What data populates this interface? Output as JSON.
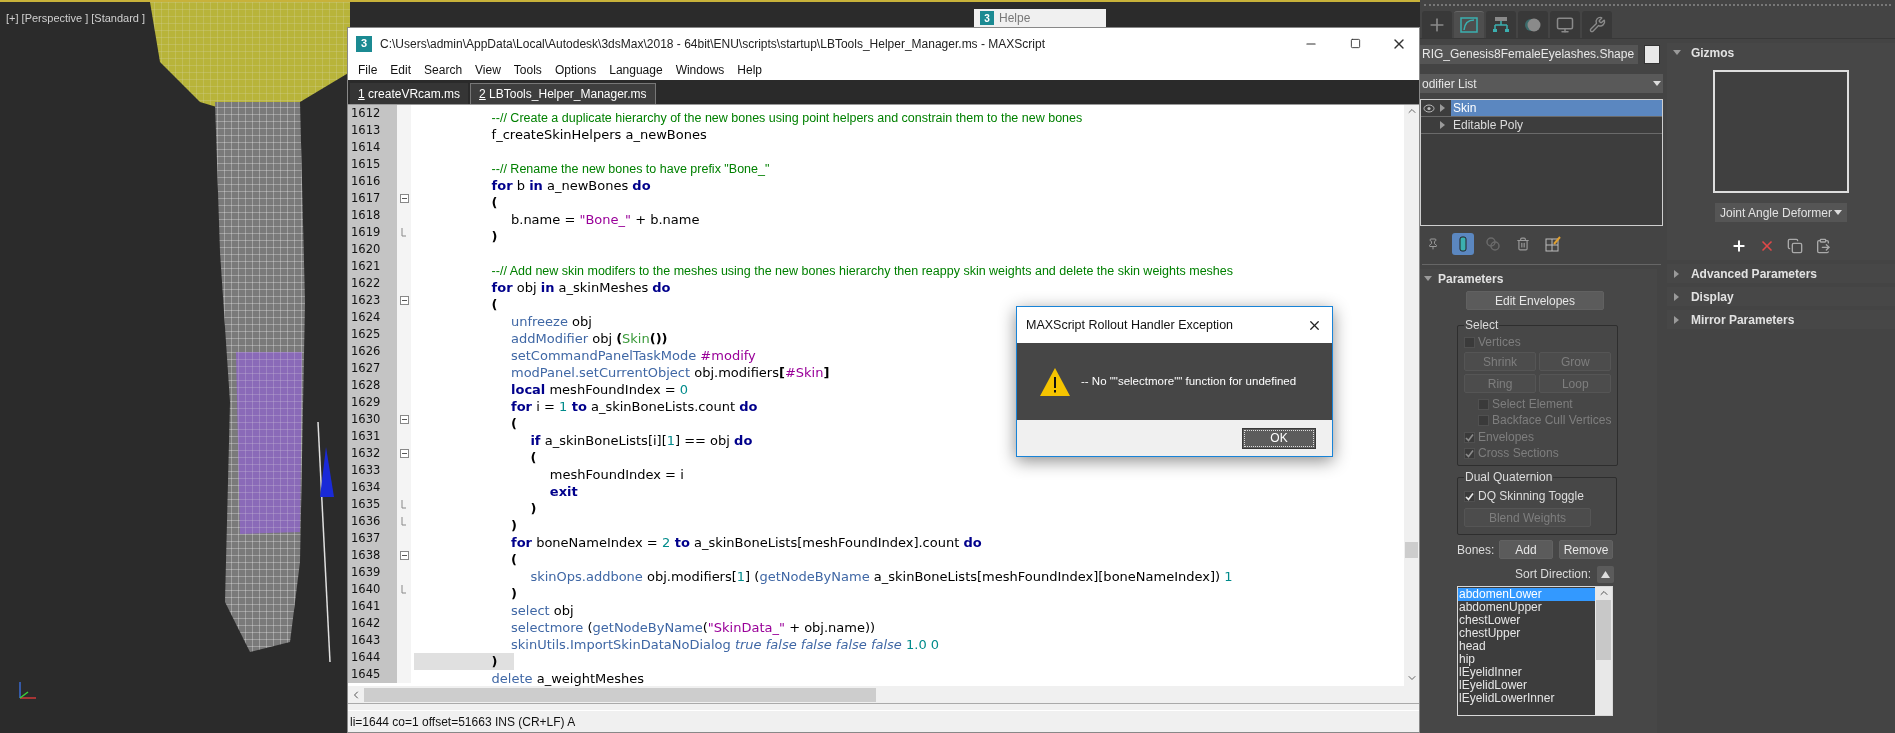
{
  "viewport": {
    "label": "[+] [Perspective ] [Standard ]"
  },
  "helper_window": {
    "logo_text": "3",
    "title": "Helpe"
  },
  "editor": {
    "logo_text": "3",
    "title": "C:\\Users\\admin\\AppData\\Local\\Autodesk\\3dsMax\\2018 - 64bit\\ENU\\scripts\\startup\\LBTools_Helper_Manager.ms - MAXScript",
    "menu": [
      "File",
      "Edit",
      "Search",
      "View",
      "Tools",
      "Options",
      "Language",
      "Windows",
      "Help"
    ],
    "tabs": [
      {
        "number": "1",
        "label": "createVRcam.ms",
        "selected": false
      },
      {
        "number": "2",
        "label": "LBTools_Helper_Manager.ms",
        "selected": true
      }
    ],
    "lines": [
      {
        "number": "1612",
        "kind": "plain",
        "current": false,
        "code": [
          {
            "text": "\t\t\t\t--// Create a duplicate hierarchy of the new bones using point helpers and constrain them to the new bones",
            "kind": "comment"
          }
        ]
      },
      {
        "number": "1613",
        "kind": "plain",
        "current": false,
        "code": [
          {
            "text": "\t\t\t\tf_createSkinHelpers a_newBones",
            "kind": "plain"
          }
        ]
      },
      {
        "number": "1614",
        "kind": "plain",
        "current": false
      },
      {
        "number": "1615",
        "kind": "plain",
        "current": false,
        "code": [
          {
            "text": "\t\t\t\t--// Rename the new bones to have prefix \"Bone_\"",
            "kind": "comment"
          }
        ]
      },
      {
        "number": "1616",
        "kind": "plain",
        "current": false,
        "code": [
          {
            "text": "\t\t\t\tfor",
            "kind": "keyword"
          },
          {
            "text": " b ",
            "kind": "plain"
          },
          {
            "text": "in",
            "kind": "keyword"
          },
          {
            "text": " a_newBones ",
            "kind": "plain"
          },
          {
            "text": "do",
            "kind": "keyword"
          }
        ]
      },
      {
        "number": "1617",
        "kind": "block-start",
        "current": false,
        "code": [
          {
            "text": "\t\t\t\t(",
            "kind": "paren"
          }
        ]
      },
      {
        "number": "1618",
        "kind": "plain",
        "current": false,
        "code": [
          {
            "text": "\t\t\t\t\tb.name = ",
            "kind": "plain"
          },
          {
            "text": "\"Bone_\"",
            "kind": "string"
          },
          {
            "text": " + b.name",
            "kind": "plain"
          }
        ]
      },
      {
        "number": "1619",
        "kind": "block-end",
        "current": false,
        "code": [
          {
            "text": "\t\t\t\t)",
            "kind": "paren"
          }
        ]
      },
      {
        "number": "1620",
        "kind": "plain",
        "current": false
      },
      {
        "number": "1621",
        "kind": "plain",
        "current": false,
        "code": [
          {
            "text": "\t\t\t\t--// Add new skin modifers to the meshes using the new bones hierarchy then reappy skin weights and delete the skin weights meshes",
            "kind": "comment"
          }
        ]
      },
      {
        "number": "1622",
        "kind": "plain",
        "current": false,
        "code": [
          {
            "text": "\t\t\t\tfor",
            "kind": "keyword"
          },
          {
            "text": " obj ",
            "kind": "plain"
          },
          {
            "text": "in",
            "kind": "keyword"
          },
          {
            "text": " a_skinMeshes ",
            "kind": "plain"
          },
          {
            "text": "do",
            "kind": "keyword"
          }
        ]
      },
      {
        "number": "1623",
        "kind": "block-start",
        "current": false,
        "code": [
          {
            "text": "\t\t\t\t(",
            "kind": "paren"
          }
        ]
      },
      {
        "number": "1624",
        "kind": "plain",
        "current": false,
        "code": [
          {
            "text": "\t\t\t\t\tunfreeze",
            "kind": "func"
          },
          {
            "text": " obj",
            "kind": "plain"
          }
        ]
      },
      {
        "number": "1625",
        "kind": "plain",
        "current": false,
        "code": [
          {
            "text": "\t\t\t\t\taddModifier",
            "kind": "func"
          },
          {
            "text": " obj ",
            "kind": "plain"
          },
          {
            "text": "(",
            "kind": "paren"
          },
          {
            "text": "Skin",
            "kind": "class"
          },
          {
            "text": "())",
            "kind": "paren"
          }
        ]
      },
      {
        "number": "1626",
        "kind": "plain",
        "current": false,
        "code": [
          {
            "text": "\t\t\t\t\tsetCommandPanelTaskMode",
            "kind": "func"
          },
          {
            "text": " #modify",
            "kind": "name"
          }
        ]
      },
      {
        "number": "1627",
        "kind": "plain",
        "current": false,
        "code": [
          {
            "text": "\t\t\t\t\tmodPanel.setCurrentObject",
            "kind": "func"
          },
          {
            "text": " obj.modifiers",
            "kind": "plain"
          },
          {
            "text": "[",
            "kind": "paren"
          },
          {
            "text": "#Skin",
            "kind": "name"
          },
          {
            "text": "]",
            "kind": "paren"
          }
        ]
      },
      {
        "number": "1628",
        "kind": "plain",
        "current": false,
        "code": [
          {
            "text": "\t\t\t\t\tlocal",
            "kind": "keyword"
          },
          {
            "text": " meshFoundIndex = ",
            "kind": "plain"
          },
          {
            "text": "0",
            "kind": "number"
          }
        ]
      },
      {
        "number": "1629",
        "kind": "plain",
        "current": false,
        "code": [
          {
            "text": "\t\t\t\t\tfor",
            "kind": "keyword"
          },
          {
            "text": " i = ",
            "kind": "plain"
          },
          {
            "text": "1",
            "kind": "number"
          },
          {
            "text": " to",
            "kind": "keyword"
          },
          {
            "text": " a_skinBoneLists.count ",
            "kind": "plain"
          },
          {
            "text": "do",
            "kind": "keyword"
          }
        ]
      },
      {
        "number": "1630",
        "kind": "block-start",
        "current": false,
        "code": [
          {
            "text": "\t\t\t\t\t(",
            "kind": "paren"
          }
        ]
      },
      {
        "number": "1631",
        "kind": "plain",
        "current": false,
        "code": [
          {
            "text": "\t\t\t\t\t\tif",
            "kind": "keyword"
          },
          {
            "text": " a_skinBoneLists[i][",
            "kind": "plain"
          },
          {
            "text": "1",
            "kind": "number"
          },
          {
            "text": "] == obj ",
            "kind": "plain"
          },
          {
            "text": "do",
            "kind": "keyword"
          }
        ]
      },
      {
        "number": "1632",
        "kind": "block-start",
        "current": false,
        "code": [
          {
            "text": "\t\t\t\t\t\t(",
            "kind": "paren"
          }
        ]
      },
      {
        "number": "1633",
        "kind": "plain",
        "current": false,
        "code": [
          {
            "text": "\t\t\t\t\t\t\tmeshFoundIndex = i",
            "kind": "plain"
          }
        ]
      },
      {
        "number": "1634",
        "kind": "plain",
        "current": false,
        "code": [
          {
            "text": "\t\t\t\t\t\t\texit",
            "kind": "keyword"
          }
        ]
      },
      {
        "number": "1635",
        "kind": "block-end",
        "current": false,
        "code": [
          {
            "text": "\t\t\t\t\t\t)",
            "kind": "paren"
          }
        ]
      },
      {
        "number": "1636",
        "kind": "block-end",
        "current": false,
        "code": [
          {
            "text": "\t\t\t\t\t)",
            "kind": "paren"
          }
        ]
      },
      {
        "number": "1637",
        "kind": "plain",
        "current": false,
        "code": [
          {
            "text": "\t\t\t\t\tfor",
            "kind": "keyword"
          },
          {
            "text": " boneNameIndex = ",
            "kind": "plain"
          },
          {
            "text": "2",
            "kind": "number"
          },
          {
            "text": " to",
            "kind": "keyword"
          },
          {
            "text": " a_skinBoneLists[meshFoundIndex].count ",
            "kind": "plain"
          },
          {
            "text": "do",
            "kind": "keyword"
          }
        ]
      },
      {
        "number": "1638",
        "kind": "block-start",
        "current": false,
        "code": [
          {
            "text": "\t\t\t\t\t(",
            "kind": "paren"
          }
        ]
      },
      {
        "number": "1639",
        "kind": "plain",
        "current": false,
        "code": [
          {
            "text": "\t\t\t\t\t\tskinOps.addbone",
            "kind": "func"
          },
          {
            "text": " obj.modifiers[",
            "kind": "plain"
          },
          {
            "text": "1",
            "kind": "number"
          },
          {
            "text": "] (",
            "kind": "plain"
          },
          {
            "text": "getNodeByName",
            "kind": "func"
          },
          {
            "text": " a_skinBoneLists[meshFoundIndex][boneNameIndex]) ",
            "kind": "plain"
          },
          {
            "text": "1",
            "kind": "number"
          }
        ]
      },
      {
        "number": "1640",
        "kind": "block-end",
        "current": false,
        "code": [
          {
            "text": "\t\t\t\t\t)",
            "kind": "paren"
          }
        ]
      },
      {
        "number": "1641",
        "kind": "plain",
        "current": false,
        "code": [
          {
            "text": "\t\t\t\t\tselect",
            "kind": "func"
          },
          {
            "text": " obj",
            "kind": "plain"
          }
        ]
      },
      {
        "number": "1642",
        "kind": "plain",
        "current": false,
        "code": [
          {
            "text": "\t\t\t\t\tselectmore",
            "kind": "func"
          },
          {
            "text": " (",
            "kind": "plain"
          },
          {
            "text": "getNodeByName",
            "kind": "func"
          },
          {
            "text": "(",
            "kind": "plain"
          },
          {
            "text": "\"SkinData_\"",
            "kind": "string"
          },
          {
            "text": " + obj.name))",
            "kind": "plain"
          }
        ]
      },
      {
        "number": "1643",
        "kind": "plain",
        "current": false,
        "code": [
          {
            "text": "\t\t\t\t\tskinUtils.ImportSkinDataNoDialog",
            "kind": "func"
          },
          {
            "text": " true false false false false",
            "kind": "bool"
          },
          {
            "text": " 1.0 0",
            "kind": "number"
          }
        ]
      },
      {
        "number": "1644",
        "kind": "plain",
        "current": true,
        "code": [
          {
            "text": "\t\t\t\t)",
            "kind": "paren"
          }
        ]
      },
      {
        "number": "1645",
        "kind": "plain",
        "current": false,
        "code": [
          {
            "text": "\t\t\t\tdelete",
            "kind": "func"
          },
          {
            "text": " a_weightMeshes",
            "kind": "plain"
          }
        ]
      }
    ],
    "status_bar": "li=1644 co=1 offset=51663 INS (CR+LF) A"
  },
  "dialog": {
    "title": "MAXScript Rollout Handler Exception",
    "message": "-- No \"\"selectmore\"\" function for undefined",
    "button": "OK"
  },
  "command_panel": {
    "tabs": [
      {
        "kind": "create",
        "selected": false
      },
      {
        "kind": "modify",
        "selected": true
      },
      {
        "kind": "hierarchy",
        "selected": false
      },
      {
        "kind": "motion",
        "selected": false
      },
      {
        "kind": "display",
        "selected": false
      },
      {
        "kind": "utilities",
        "selected": false
      }
    ],
    "object_name": "RIG_Genesis8FemaleEyelashes.Shape",
    "modifier_list": "odifier List",
    "stack": [
      {
        "label": "Skin",
        "selected": true
      },
      {
        "label": "Editable Poly",
        "selected": false
      }
    ],
    "stack_tools": [
      {
        "kind": "pin",
        "active": false
      },
      {
        "kind": "end-result",
        "active": true
      },
      {
        "kind": "unique",
        "active": false
      },
      {
        "kind": "remove",
        "active": false
      },
      {
        "kind": "configure",
        "active": false
      }
    ],
    "parameters": {
      "title": "Parameters",
      "expanded": true,
      "edit_envelopes": {
        "label": "Edit Envelopes",
        "disabled": false
      },
      "select_group": {
        "title": "Select",
        "vertices": {
          "label": "Vertices",
          "checked": false,
          "disabled": true
        },
        "buttons": [
          {
            "label": "Shrink",
            "disabled": true
          },
          {
            "label": "Grow",
            "disabled": true
          },
          {
            "label": "Ring",
            "disabled": true
          },
          {
            "label": "Loop",
            "disabled": true
          }
        ],
        "options": [
          {
            "label": "Select Element",
            "checked": false,
            "disabled": true
          },
          {
            "label": "Backface Cull Vertices",
            "checked": false,
            "disabled": true
          }
        ],
        "display": [
          {
            "label": "Envelopes",
            "checked": true,
            "disabled": true
          },
          {
            "label": "Cross Sections",
            "checked": true,
            "disabled": true
          }
        ]
      },
      "dq_group": {
        "title": "Dual Quaternion",
        "toggle": {
          "label": "DQ Skinning Toggle",
          "checked": true,
          "disabled": false
        },
        "blend_weights": {
          "label": "Blend Weights",
          "disabled": true
        }
      },
      "bones_label": "Bones:",
      "bone_buttons": [
        {
          "label": "Add",
          "disabled": false
        },
        {
          "label": "Remove",
          "disabled": false
        }
      ],
      "sort_label": "Sort Direction:",
      "bones": [
        {
          "label": "abdomenLower",
          "selected": true
        },
        {
          "label": "abdomenUpper",
          "selected": false
        },
        {
          "label": "chestLower",
          "selected": false
        },
        {
          "label": "chestUpper",
          "selected": false
        },
        {
          "label": "head",
          "selected": false
        },
        {
          "label": "hip",
          "selected": false
        },
        {
          "label": "lEyelidInner",
          "selected": false
        },
        {
          "label": "lEyelidLower",
          "selected": false
        },
        {
          "label": "lEyelidLowerInner",
          "selected": false
        }
      ]
    },
    "rollouts": [
      {
        "title": "Gizmos",
        "expanded": true
      },
      {
        "title": "Advanced Parameters",
        "expanded": false
      },
      {
        "title": "Display",
        "expanded": false
      },
      {
        "title": "Mirror Parameters",
        "expanded": false
      }
    ],
    "gizmo_type": "Joint Angle Deformer"
  }
}
